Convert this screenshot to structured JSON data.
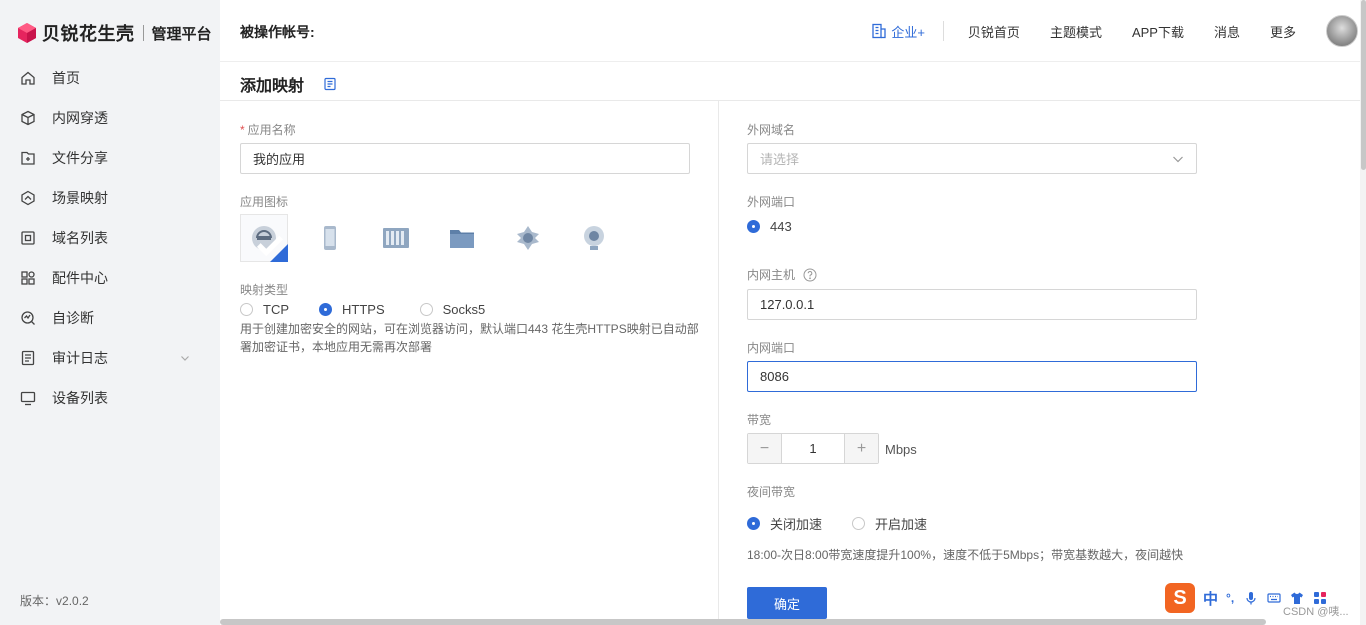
{
  "brand": {
    "name": "贝锐花生壳",
    "subtitle": "管理平台",
    "color": "#e6245e"
  },
  "sidebar": {
    "items": [
      {
        "label": "首页",
        "icon": "home-icon"
      },
      {
        "label": "内网穿透",
        "icon": "cube-icon"
      },
      {
        "label": "文件分享",
        "icon": "folder-share-icon"
      },
      {
        "label": "场景映射",
        "icon": "scene-icon"
      },
      {
        "label": "域名列表",
        "icon": "domain-icon"
      },
      {
        "label": "配件中心",
        "icon": "grid-icon"
      },
      {
        "label": "自诊断",
        "icon": "diagnose-icon"
      },
      {
        "label": "审计日志",
        "icon": "log-icon",
        "expandable": true
      },
      {
        "label": "设备列表",
        "icon": "monitor-icon"
      }
    ],
    "version_label": "版本：",
    "version": "v2.0.2"
  },
  "header": {
    "account_label": "被操作帐号:",
    "enterprise": "企业+",
    "links": [
      "贝锐首页",
      "主题模式",
      "APP下载",
      "消息",
      "更多"
    ]
  },
  "page": {
    "title": "添加映射"
  },
  "form": {
    "app_name": {
      "label": "应用名称",
      "value": "我的应用"
    },
    "app_icon": {
      "label": "应用图标",
      "selected_index": 0
    },
    "mapping_type": {
      "label": "映射类型",
      "options": [
        "TCP",
        "HTTPS",
        "Socks5"
      ],
      "selected": "HTTPS",
      "description": "用于创建加密安全的网站，可在浏览器访问，默认端口443 花生壳HTTPS映射已自动部署加密证书，本地应用无需再次部署"
    },
    "external_domain": {
      "label": "外网域名",
      "placeholder": "请选择"
    },
    "external_port": {
      "label": "外网端口",
      "option": "443"
    },
    "internal_host": {
      "label": "内网主机",
      "value": "127.0.0.1"
    },
    "internal_port": {
      "label": "内网端口",
      "value": "8086"
    },
    "bandwidth": {
      "label": "带宽",
      "value": "1",
      "unit": "Mbps",
      "minus": "−",
      "plus": "+"
    },
    "night_bandwidth": {
      "label": "夜间带宽",
      "options": [
        "关闭加速",
        "开启加速"
      ],
      "selected": "关闭加速",
      "hint": "18:00-次日8:00带宽速度提升100%，速度不低于5Mbps；带宽基数越大，夜间越快"
    },
    "submit_label": "确定"
  },
  "ime": {
    "logo": "S",
    "lang": "中",
    "punct": "°,"
  },
  "watermark": "CSDN @咦...",
  "colors": {
    "primary": "#2f6bd8",
    "sidebar_bg": "#f2f3f5",
    "required": "#e05050"
  }
}
